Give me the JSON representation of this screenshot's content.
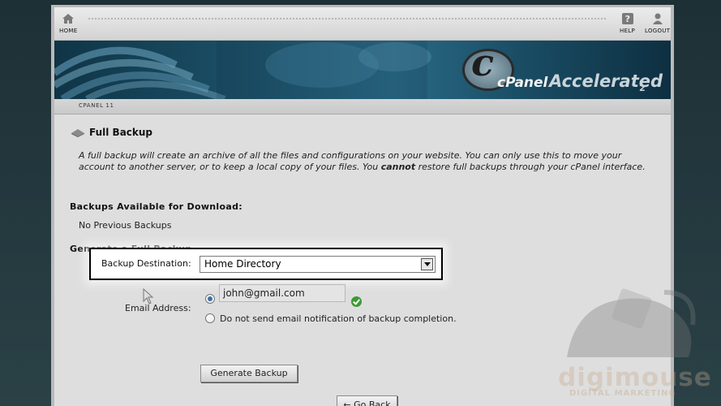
{
  "toolbar": {
    "home_label": "HOME",
    "help_label": "HELP",
    "logout_label": "LOGOUT"
  },
  "banner": {
    "logo_c": "c",
    "logo_panel": "cPanel",
    "logo_accelerated": "Accelerated",
    "logo_version": "2"
  },
  "breadcrumb": "CPANEL 11",
  "page": {
    "title": "Full Backup",
    "description_part1": "A full backup will create an archive of all the files and configurations on your website. You can only use this to move your account to another server, or to keep a local copy of your files. You ",
    "description_bold": "cannot",
    "description_part2": " restore full backups through your cPanel interface."
  },
  "available": {
    "heading": "Backups Available for Download:",
    "none_text": "No Previous Backups"
  },
  "generate": {
    "heading": "Generate a Full Backup",
    "destination_label": "Backup Destination:",
    "destination_value": "Home Directory",
    "email_label": "Email Address:",
    "email_value": "john@gmail.com",
    "no_email_text": "Do not send email notification of backup completion.",
    "generate_button": "Generate Backup",
    "go_back_button": "← Go Back"
  },
  "watermark": {
    "brand": "digimouse",
    "tagline": "DIGITAL MARKETING"
  },
  "colors": {
    "highlight_border": "#000000",
    "radio_selected": "#3a6ea5",
    "check_green": "#3c9a35"
  }
}
